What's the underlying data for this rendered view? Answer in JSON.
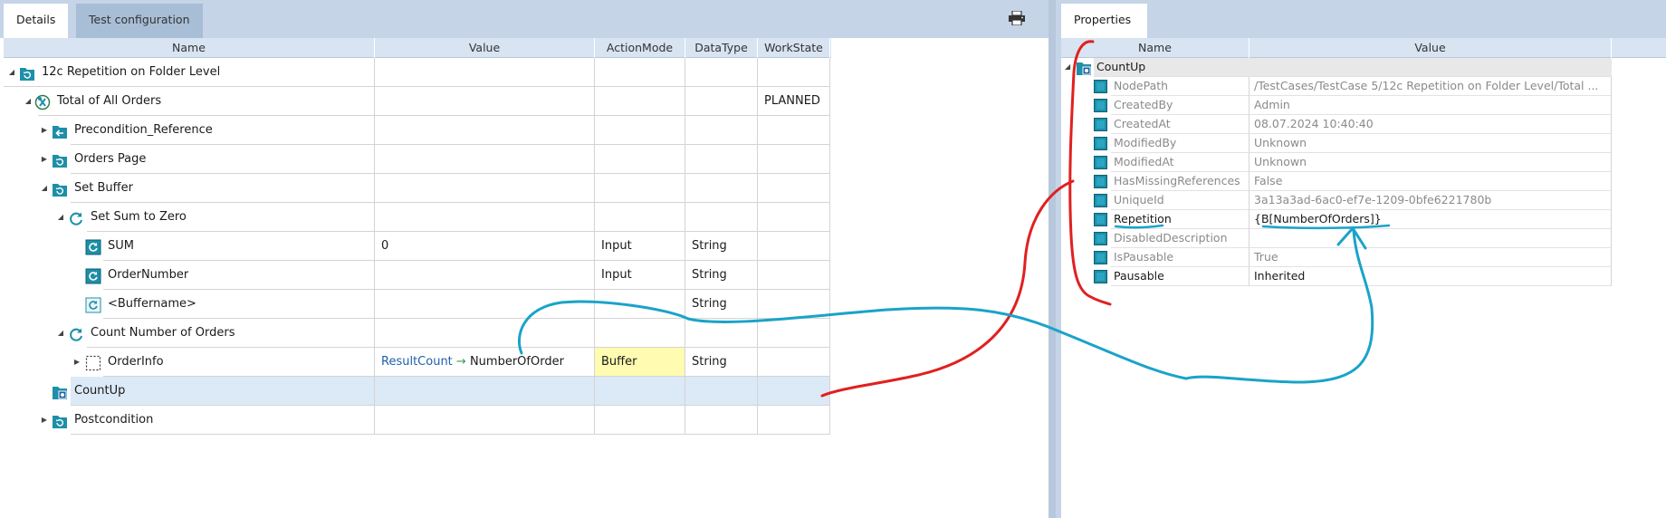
{
  "left_panel": {
    "tabs": [
      {
        "label": "Details",
        "active": true
      },
      {
        "label": "Test configuration",
        "active": false
      }
    ],
    "columns": [
      "Name",
      "Value",
      "ActionMode",
      "DataType",
      "WorkState"
    ],
    "rows": [
      {
        "name": "12c Repetition on Folder Level",
        "level": 0,
        "expander": "expanded",
        "icon": "folder-repeat-icon",
        "value": "",
        "action_mode": "",
        "data_type": "",
        "work_state": ""
      },
      {
        "name": "Total of All Orders",
        "level": 1,
        "expander": "expanded",
        "icon": "testcase-icon",
        "value": "",
        "action_mode": "",
        "data_type": "",
        "work_state": "PLANNED"
      },
      {
        "name": "Precondition_Reference",
        "level": 2,
        "expander": "collapsed",
        "icon": "reference-icon",
        "value": "",
        "action_mode": "",
        "data_type": "",
        "work_state": ""
      },
      {
        "name": "Orders Page",
        "level": 2,
        "expander": "collapsed",
        "icon": "folder-repeat-icon",
        "value": "",
        "action_mode": "",
        "data_type": "",
        "work_state": ""
      },
      {
        "name": "Set  Buffer",
        "level": 2,
        "expander": "expanded",
        "icon": "folder-repeat-icon",
        "value": "",
        "action_mode": "",
        "data_type": "",
        "work_state": ""
      },
      {
        "name": "Set Sum to Zero",
        "level": 3,
        "expander": "expanded",
        "icon": "refresh-icon",
        "value": "",
        "action_mode": "",
        "data_type": "",
        "work_state": ""
      },
      {
        "name": "SUM",
        "level": 4,
        "expander": "none",
        "icon": "module-attribute-icon",
        "value": "0",
        "action_mode": "Input",
        "data_type": "String",
        "work_state": ""
      },
      {
        "name": "OrderNumber",
        "level": 4,
        "expander": "none",
        "icon": "module-attribute-icon",
        "value": "",
        "action_mode": "Input",
        "data_type": "String",
        "work_state": ""
      },
      {
        "name": "<Buffername>",
        "level": 4,
        "expander": "none",
        "icon": "module-attribute-light-icon",
        "value": "",
        "action_mode": "",
        "data_type": "String",
        "work_state": ""
      },
      {
        "name": "Count Number of Orders",
        "level": 3,
        "expander": "expanded",
        "icon": "refresh-icon",
        "value": "",
        "action_mode": "",
        "data_type": "",
        "work_state": ""
      },
      {
        "name": "OrderInfo",
        "level": 4,
        "expander": "collapsed",
        "icon": "dotted-box-icon",
        "value_parts": {
          "left": "ResultCount",
          "arrow": "→",
          "right": "NumberOfOrder"
        },
        "action_mode": "Buffer",
        "data_type": "String",
        "work_state": ""
      },
      {
        "name": "CountUp",
        "level": 2,
        "expander": "none",
        "icon": "countup-icon",
        "value": "",
        "action_mode": "",
        "data_type": "",
        "work_state": "",
        "selected": true
      },
      {
        "name": "Postcondition",
        "level": 2,
        "expander": "collapsed",
        "icon": "folder-repeat-icon",
        "value": "",
        "action_mode": "",
        "data_type": "",
        "work_state": ""
      }
    ]
  },
  "right_panel": {
    "tabs": [
      {
        "label": "Properties",
        "active": true
      }
    ],
    "columns": [
      "Name",
      "Value"
    ],
    "root": {
      "name": "CountUp",
      "icon": "countup-icon"
    },
    "properties": [
      {
        "name": "NodePath",
        "value": "/TestCases/TestCase 5/12c Repetition on Folder Level/Total ...",
        "gray": true
      },
      {
        "name": "CreatedBy",
        "value": "Admin",
        "gray": true
      },
      {
        "name": "CreatedAt",
        "value": "08.07.2024 10:40:40",
        "gray": true
      },
      {
        "name": "ModifiedBy",
        "value": "Unknown",
        "gray": true
      },
      {
        "name": "ModifiedAt",
        "value": "Unknown",
        "gray": true
      },
      {
        "name": "HasMissingReferences",
        "value": "False",
        "gray": true
      },
      {
        "name": "UniqueId",
        "value": "3a13a3ad-6ac0-ef7e-1209-0bfe6221780b",
        "gray": true
      },
      {
        "name": "Repetition",
        "value": "{B[NumberOfOrders]}",
        "gray": false
      },
      {
        "name": "DisabledDescription",
        "value": "",
        "gray": true
      },
      {
        "name": "IsPausable",
        "value": "True",
        "gray": true
      },
      {
        "name": "Pausable",
        "value": "Inherited",
        "gray": false
      }
    ]
  },
  "colors": {
    "tab_bar": "#c5d4e6",
    "header": "#d8e4f2",
    "selected_row": "#dce9f7",
    "buffer_highlight": "#fffbb0",
    "icon_teal": "#1e8fa8",
    "annotation_red": "#e02020",
    "annotation_blue": "#1aa3c9"
  }
}
